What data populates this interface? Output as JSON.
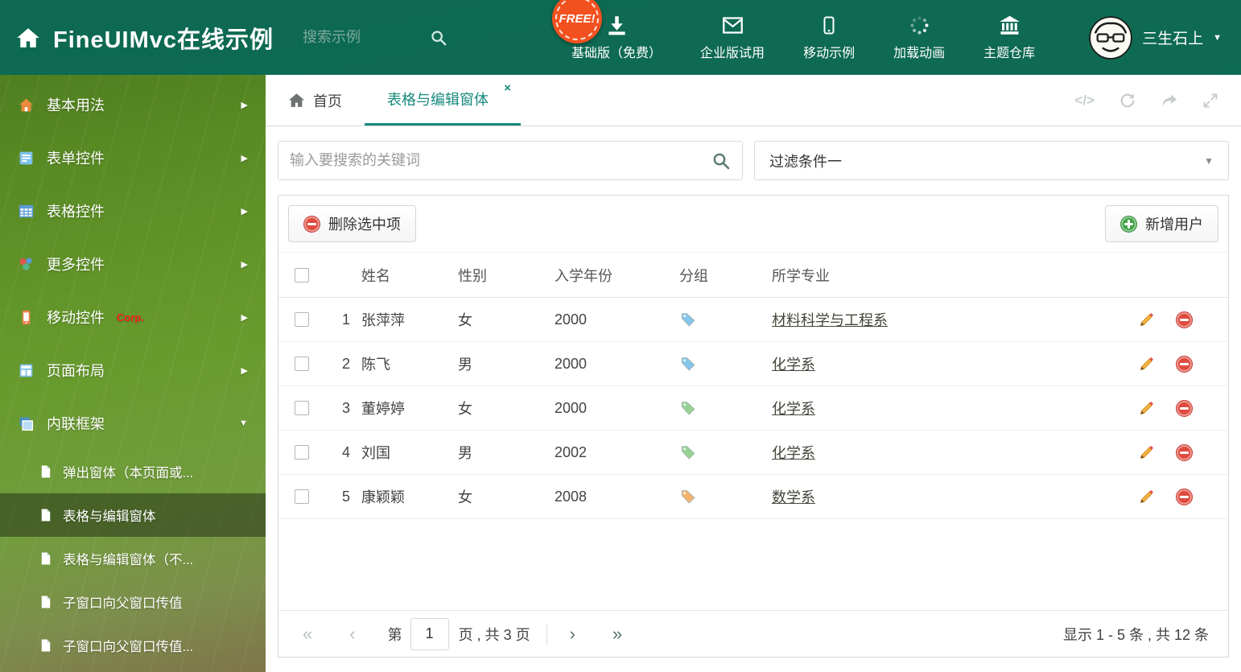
{
  "header": {
    "title": "FineUIMvc在线示例",
    "search_placeholder": "搜索示例",
    "free_badge": "FREE!",
    "nav_items": [
      {
        "label": "基础版（免费）",
        "icon": "download-icon"
      },
      {
        "label": "企业版试用",
        "icon": "envelope-icon"
      },
      {
        "label": "移动示例",
        "icon": "mobile-icon"
      },
      {
        "label": "加载动画",
        "icon": "spinner-icon"
      },
      {
        "label": "主题仓库",
        "icon": "bank-icon"
      }
    ],
    "user_name": "三生石上"
  },
  "sidebar": {
    "items": [
      {
        "label": "基本用法",
        "icon": "home-icon"
      },
      {
        "label": "表单控件",
        "icon": "form-icon"
      },
      {
        "label": "表格控件",
        "icon": "table-icon"
      },
      {
        "label": "更多控件",
        "icon": "widgets-icon"
      },
      {
        "label": "移动控件",
        "badge": "Corp.",
        "icon": "mobile-icon"
      },
      {
        "label": "页面布局",
        "icon": "layout-icon"
      },
      {
        "label": "内联框架",
        "icon": "frame-icon"
      }
    ],
    "subitems": [
      {
        "label": "弹出窗体（本页面或..."
      },
      {
        "label": "表格与编辑窗体"
      },
      {
        "label": "表格与编辑窗体（不..."
      },
      {
        "label": "子窗口向父窗口传值"
      },
      {
        "label": "子窗口向父窗口传值..."
      }
    ]
  },
  "tabs": [
    {
      "label": "首页",
      "icon": "home-icon"
    },
    {
      "label": "表格与编辑窗体",
      "active": true
    }
  ],
  "filter_bar": {
    "search_placeholder": "输入要搜索的关键词",
    "filter_value": "过滤条件一"
  },
  "toolbar": {
    "delete_label": "删除选中项",
    "add_label": "新增用户"
  },
  "table": {
    "columns": [
      "姓名",
      "性别",
      "入学年份",
      "分组",
      "所学专业"
    ],
    "rows": [
      {
        "num": "1",
        "name": "张萍萍",
        "gender": "女",
        "year": "2000",
        "tag_color": "#86c5ec",
        "major": "材料科学与工程系"
      },
      {
        "num": "2",
        "name": "陈飞",
        "gender": "男",
        "year": "2000",
        "tag_color": "#86c5ec",
        "major": "化学系"
      },
      {
        "num": "3",
        "name": "董婷婷",
        "gender": "女",
        "year": "2000",
        "tag_color": "#96d296",
        "major": "化学系"
      },
      {
        "num": "4",
        "name": "刘国",
        "gender": "男",
        "year": "2002",
        "tag_color": "#96d296",
        "major": "化学系"
      },
      {
        "num": "5",
        "name": "康颖颖",
        "gender": "女",
        "year": "2008",
        "tag_color": "#f4b26d",
        "major": "数学系"
      }
    ]
  },
  "pagination": {
    "page_prefix": "第",
    "current_page": "1",
    "page_suffix": "页 , 共 3 页",
    "summary": "显示 1 - 5 条 , 共 12 条"
  },
  "icons": {
    "caret_down": "▼",
    "chevron_right": "▶",
    "chevron_down": "▼",
    "close": "×",
    "code": "</>",
    "pager_first": "«",
    "pager_prev": "‹",
    "pager_next": "›",
    "pager_last": "»"
  },
  "colors": {
    "header_bg": "#0a6854",
    "accent_teal": "#17897c",
    "delete_red": "#e04b3f",
    "add_green": "#3fa346"
  }
}
